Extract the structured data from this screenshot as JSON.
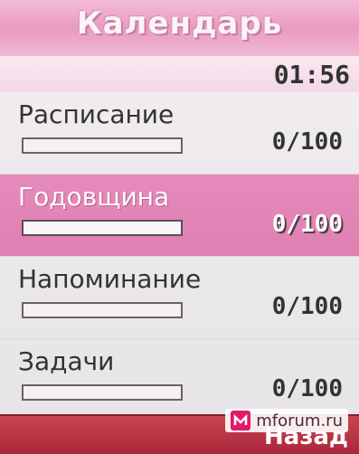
{
  "header": {
    "title": "Календарь"
  },
  "status": {
    "time": "01:56"
  },
  "items": [
    {
      "label": "Расписание",
      "usage": "0/100",
      "fill": 0
    },
    {
      "label": "Годовщина",
      "usage": "0/100",
      "fill": 0
    },
    {
      "label": "Напоминание",
      "usage": "0/100",
      "fill": 0
    },
    {
      "label": "Задачи",
      "usage": "0/100",
      "fill": 0
    }
  ],
  "softkeys": {
    "right": "Назад"
  },
  "watermark": {
    "text": "mforum.ru"
  },
  "colors": {
    "header": "#e99ac1",
    "selection": "#e58bbb",
    "softbar": "#b7303f"
  }
}
